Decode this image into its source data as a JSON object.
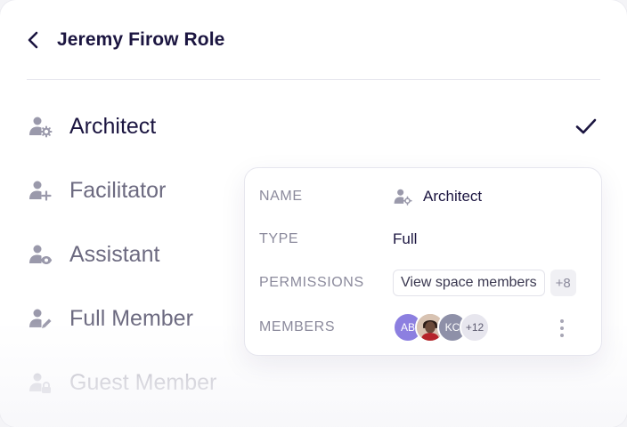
{
  "header": {
    "title": "Jeremy Firow Role",
    "back_icon": "chevron-left-icon"
  },
  "roles": [
    {
      "label": "Architect",
      "icon": "user-gear-icon",
      "selected": true
    },
    {
      "label": "Facilitator",
      "icon": "user-plus-icon",
      "selected": false
    },
    {
      "label": "Assistant",
      "icon": "user-eye-icon",
      "selected": false
    },
    {
      "label": "Full Member",
      "icon": "user-pen-icon",
      "selected": false
    },
    {
      "label": "Guest Member",
      "icon": "user-lock-icon",
      "selected": false
    }
  ],
  "details": {
    "name_label": "NAME",
    "name_value": "Architect",
    "type_label": "TYPE",
    "type_value": "Full",
    "permissions_label": "PERMISSIONS",
    "permission_chip": "View space members",
    "permission_more": "+8",
    "members_label": "MEMBERS",
    "members": [
      {
        "initials": "AB",
        "color": "#8c7fe0"
      },
      {
        "initials": "",
        "color": "#6b4a3a"
      },
      {
        "initials": "KC",
        "color": "#8e90a8"
      }
    ],
    "members_more": "+12"
  },
  "colors": {
    "primary_text": "#1b1540",
    "muted_text": "#6c6a80",
    "icon_gray": "#9a99ab"
  }
}
